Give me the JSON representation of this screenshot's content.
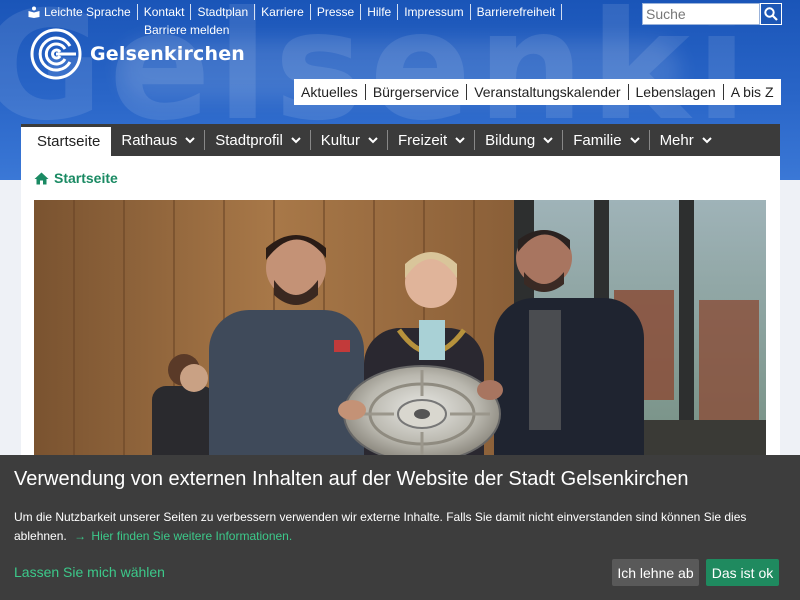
{
  "header": {
    "watermark": "Gelsenki",
    "top_links": [
      {
        "label": "Leichte Sprache",
        "icon": "easy-language-icon"
      },
      {
        "label": "Kontakt"
      },
      {
        "label": "Stadtplan"
      },
      {
        "label": "Karriere"
      },
      {
        "label": "Presse"
      },
      {
        "label": "Hilfe"
      },
      {
        "label": "Impressum"
      },
      {
        "label": "Barrierefreiheit"
      },
      {
        "label": "Barriere melden"
      }
    ],
    "search": {
      "placeholder": "Suche",
      "icon": "search-icon"
    },
    "logo_text": "Gelsenkirchen",
    "quick_nav": [
      "Aktuelles",
      "Bürgerservice",
      "Veranstaltungskalender",
      "Lebenslagen",
      "A bis Z"
    ]
  },
  "main_nav": [
    {
      "label": "Startseite",
      "active": true
    },
    {
      "label": "Rathaus",
      "dropdown": true
    },
    {
      "label": "Stadtprofil",
      "dropdown": true
    },
    {
      "label": "Kultur",
      "dropdown": true
    },
    {
      "label": "Freizeit",
      "dropdown": true
    },
    {
      "label": "Bildung",
      "dropdown": true
    },
    {
      "label": "Familie",
      "dropdown": true
    },
    {
      "label": "Mehr",
      "dropdown": true
    }
  ],
  "breadcrumb": {
    "label": "Startseite",
    "icon": "home-icon"
  },
  "cookie": {
    "title": "Verwendung von externen Inhalten auf der Website der Stadt Gelsenkirchen",
    "text": "Um die Nutzbarkeit unserer Seiten zu verbessern verwenden wir externe Inhalte. Falls Sie damit nicht einverstanden sind können Sie dies ablehnen.",
    "more_link": "Hier finden Sie weitere Informationen.",
    "choose_link": "Lassen Sie mich wählen",
    "decline_label": "Ich lehne ab",
    "accept_label": "Das ist ok"
  },
  "colors": {
    "header_blue": "#2a66c8",
    "nav_dark": "#3b3b3b",
    "accent_green": "#1a8a63",
    "cookie_bg": "#3d3d3d",
    "accept_green": "#1f8a5f"
  }
}
